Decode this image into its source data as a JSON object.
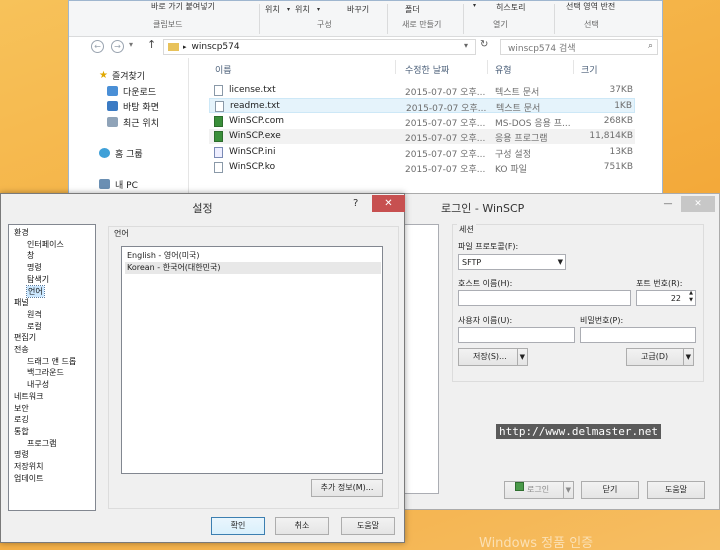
{
  "explorer": {
    "ribbon": {
      "items": [
        "바로 가기 붙여넣기",
        "위치",
        "위치",
        "바꾸기",
        "폴더",
        "히스토리",
        "선택 영역 반전"
      ],
      "groups": [
        "클립보드",
        "구성",
        "새로 만들기",
        "열기",
        "선택"
      ]
    },
    "address": {
      "path": "winscp574",
      "arrow": "▸"
    },
    "search": {
      "placeholder": "winscp574 검색"
    },
    "nav": {
      "favorites": "즐겨찾기",
      "items": [
        "다운로드",
        "바탕 화면",
        "최근 위치"
      ],
      "homegroup": "홈 그룹",
      "pc": "내 PC"
    },
    "columns": {
      "name": "이름",
      "date": "수정한 날짜",
      "type": "유형",
      "size": "크기"
    },
    "files": [
      {
        "name": "license.txt",
        "date": "2015-07-07 오후...",
        "type": "텍스트 문서",
        "size": "37KB"
      },
      {
        "name": "readme.txt",
        "date": "2015-07-07 오후...",
        "type": "텍스트 문서",
        "size": "1KB"
      },
      {
        "name": "WinSCP.com",
        "date": "2015-07-07 오후...",
        "type": "MS-DOS 응용 프...",
        "size": "268KB"
      },
      {
        "name": "WinSCP.exe",
        "date": "2015-07-07 오후...",
        "type": "응용 프로그램",
        "size": "11,814KB"
      },
      {
        "name": "WinSCP.ini",
        "date": "2015-07-07 오후...",
        "type": "구성 설정",
        "size": "13KB"
      },
      {
        "name": "WinSCP.ko",
        "date": "2015-07-07 오후...",
        "type": "KO 파일",
        "size": "751KB"
      }
    ]
  },
  "login": {
    "title": "로그인 - WinSCP",
    "session_group": "세션",
    "protocol_label": "파일 프로토콜(F):",
    "protocol_value": "SFTP",
    "host_label": "호스트 이름(H):",
    "host_value": "",
    "port_label": "포트 번호(R):",
    "port_value": "22",
    "user_label": "사용자 이름(U):",
    "user_value": "",
    "password_label": "비밀번호(P):",
    "password_value": "",
    "save_button": "저장(S)...",
    "advanced_button": "고급(D)",
    "login_button": "로그인",
    "close_button": "닫기",
    "help_button": "도움말",
    "watermark": "http://www.delmaster.net"
  },
  "settings": {
    "title": "설정",
    "help_glyph": "?",
    "close_glyph": "✕",
    "tree": [
      {
        "label": "환경",
        "level": 0
      },
      {
        "label": "인터페이스",
        "level": 1
      },
      {
        "label": "창",
        "level": 1
      },
      {
        "label": "명령",
        "level": 1
      },
      {
        "label": "탐색기",
        "level": 1
      },
      {
        "label": "언어",
        "level": 1,
        "selected": true
      },
      {
        "label": "패널",
        "level": 0
      },
      {
        "label": "원격",
        "level": 1
      },
      {
        "label": "로컬",
        "level": 1
      },
      {
        "label": "편집기",
        "level": 0
      },
      {
        "label": "전송",
        "level": 0
      },
      {
        "label": "드래그 앤 드롭",
        "level": 1
      },
      {
        "label": "백그라운드",
        "level": 1
      },
      {
        "label": "내구성",
        "level": 1
      },
      {
        "label": "네트워크",
        "level": 0
      },
      {
        "label": "보안",
        "level": 0
      },
      {
        "label": "로깅",
        "level": 0
      },
      {
        "label": "통합",
        "level": 0
      },
      {
        "label": "프로그램",
        "level": 1
      },
      {
        "label": "명령",
        "level": 0
      },
      {
        "label": "저장위치",
        "level": 0
      },
      {
        "label": "업데이트",
        "level": 0
      }
    ],
    "language_group": "언어",
    "languages": [
      {
        "label": "English - 영어(미국)",
        "selected": false
      },
      {
        "label": "Korean - 한국어(대한민국)",
        "selected": true
      }
    ],
    "more_info_button": "추가 정보(M)...",
    "ok_button": "확인",
    "cancel_button": "취소",
    "help_button": "도움말"
  },
  "desktop": {
    "activation_text": "Windows 정품 인증"
  },
  "colors": {
    "accent": "#3c7fb1",
    "close_red": "#c75050",
    "desktop": "#f3a93a"
  }
}
